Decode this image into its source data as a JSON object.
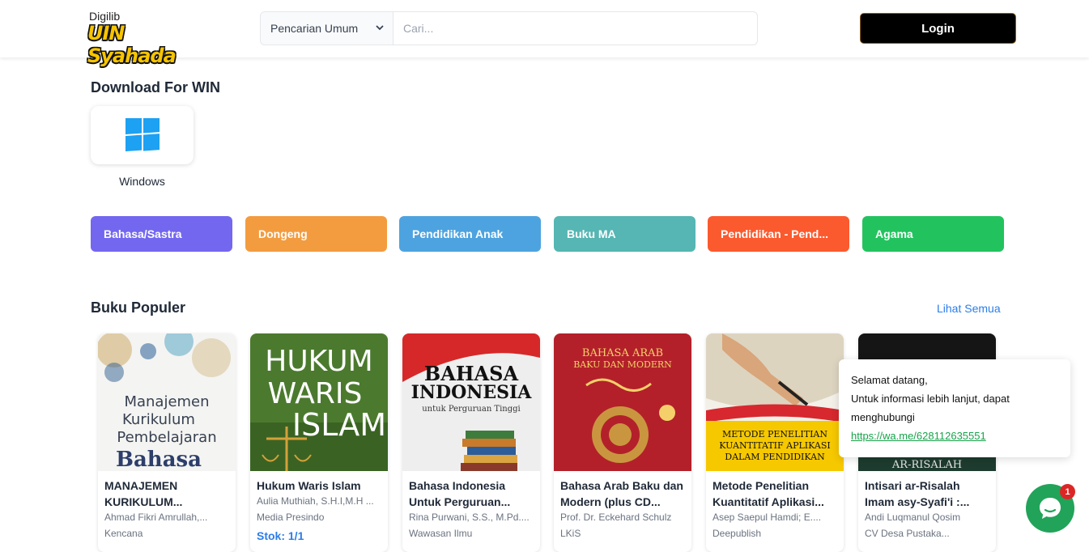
{
  "header": {
    "logo_small": "Digilib",
    "logo_big": "UIN Syahada",
    "search_type": "Pencarian Umum",
    "search_placeholder": "Cari...",
    "login_label": "Login"
  },
  "download": {
    "title": "Download For WIN",
    "windows_label": "Windows"
  },
  "categories": [
    {
      "label": "Bahasa/Sastra",
      "color": "#7367f0"
    },
    {
      "label": "Dongeng",
      "color": "#f39c3f"
    },
    {
      "label": "Pendidikan Anak",
      "color": "#4da3df"
    },
    {
      "label": "Buku MA",
      "color": "#55b6b3"
    },
    {
      "label": "Pendidikan - Pend...",
      "color": "#fb5a2e"
    },
    {
      "label": "Agama",
      "color": "#22c35e"
    }
  ],
  "popular": {
    "title": "Buku Populer",
    "see_all": "Lihat Semua",
    "books": [
      {
        "title": "MANAJEMEN KURIKULUM...",
        "author": "Ahmad Fikri Amrullah,...",
        "publisher": "Kencana",
        "cover_lines": [
          "Manajemen",
          "Kurikulum",
          "Pembelajaran",
          "Bahasa"
        ]
      },
      {
        "title": "Hukum Waris Islam",
        "author": "Aulia Muthiah, S.H.I,M.H ...",
        "publisher": "Media Presindo",
        "stock": "Stok: 1/1",
        "cover_lines": [
          "HUKUM",
          "WARIS",
          "ISLAM"
        ]
      },
      {
        "title": "Bahasa Indonesia Untuk Perguruan...",
        "author": "Rina Purwani, S.S., M.Pd....",
        "publisher": "Wawasan Ilmu",
        "cover_lines": [
          "BAHASA",
          "INDONESIA",
          "untuk Perguruan Tinggi"
        ]
      },
      {
        "title": "Bahasa Arab Baku dan Modern (plus CD...",
        "author": "Prof. Dr. Eckehard Schulz",
        "publisher": "LKiS",
        "cover_lines": [
          "BAHASA ARAB",
          "BAKU DAN MODERN"
        ]
      },
      {
        "title": "Metode Penelitian Kuantitatif Aplikasi...",
        "author": "Asep Saepul Hamdi; E....",
        "publisher": "Deepublish",
        "cover_lines": [
          "METODE PENELITIAN",
          "KUANTITATIF APLIKASI",
          "DALAM PENDIDIKAN"
        ]
      },
      {
        "title": "Intisari ar-Risalah Imam asy-Syafi'i :...",
        "author": "Andi Luqmanul Qosim",
        "publisher": "CV Desa Pustaka...",
        "cover_lines": [
          "AR-RISALAH"
        ]
      }
    ]
  },
  "chat": {
    "line1": "Selamat datang,",
    "line2": "Untuk informasi lebih lanjut, dapat menghubungi",
    "link": "https://wa.me/628112635551",
    "badge": "1"
  }
}
